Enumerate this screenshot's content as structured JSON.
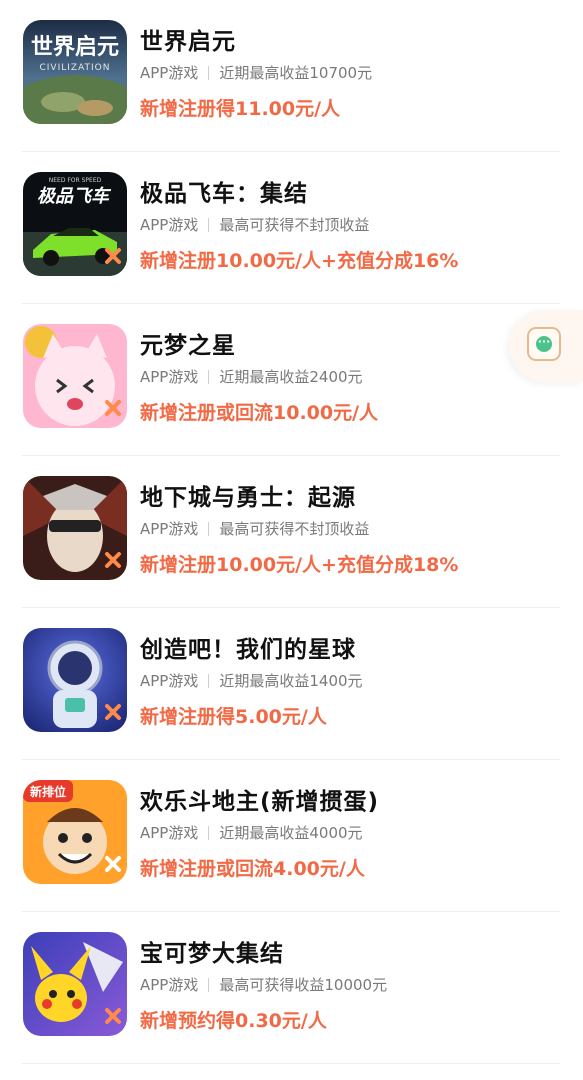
{
  "apps": [
    {
      "title": "世界启元",
      "category": "APP游戏",
      "earning": "近期最高收益10700元",
      "reward": "新增注册得11.00元/人",
      "icon": "civilization-game-icon",
      "icon_text": "世界启元",
      "icon_subtext": "CIVILIZATION",
      "colors": [
        "#1c2c44",
        "#4e6f8e",
        "#c8b170"
      ]
    },
    {
      "title": "极品飞车：集结",
      "category": "APP游戏",
      "earning": "最高可获得不封顶收益",
      "reward": "新增注册10.00元/人+充值分成16%",
      "icon": "racing-car-game-icon",
      "icon_text": "极品飞车",
      "icon_subtext": "NEED FOR SPEED",
      "colors": [
        "#0b0f14",
        "#2b3a33",
        "#7ee02a"
      ]
    },
    {
      "title": "元梦之星",
      "category": "APP游戏",
      "earning": "近期最高收益2400元",
      "reward": "新增注册或回流10.00元/人",
      "icon": "cute-character-game-icon",
      "colors": [
        "#ffd0df",
        "#ff9fc0",
        "#f4c13b"
      ]
    },
    {
      "title": "地下城与勇士：起源",
      "category": "APP游戏",
      "earning": "最高可获得不封顶收益",
      "reward": "新增注册10.00元/人+充值分成18%",
      "icon": "warrior-character-game-icon",
      "colors": [
        "#3a1d18",
        "#c25a3a",
        "#e8d9c8"
      ]
    },
    {
      "title": "创造吧！我们的星球",
      "category": "APP游戏",
      "earning": "近期最高收益1400元",
      "reward": "新增注册得5.00元/人",
      "icon": "astronaut-game-icon",
      "colors": [
        "#1f2a7a",
        "#5a6de0",
        "#dfe6f5"
      ]
    },
    {
      "title": "欢乐斗地主(新增掼蛋)",
      "category": "APP游戏",
      "earning": "近期最高收益4000元",
      "reward": "新增注册或回流4.00元/人",
      "icon": "card-game-character-icon",
      "icon_text": "新排位",
      "colors": [
        "#ff8a1e",
        "#ffc23a",
        "#f7d9b5"
      ]
    },
    {
      "title": "宝可梦大集结",
      "category": "APP游戏",
      "earning": "最高可获得收益10000元",
      "reward": "新增预约得0.30元/人",
      "icon": "pikachu-game-icon",
      "colors": [
        "#3b3fb8",
        "#8a5ad8",
        "#ffd628"
      ]
    }
  ],
  "floating_button": {
    "icon": "chat-bubble-icon",
    "glyph": "···",
    "accent": "#e8b98c",
    "bubble_color": "#4cc38a"
  },
  "reward_color": "#f26a45"
}
